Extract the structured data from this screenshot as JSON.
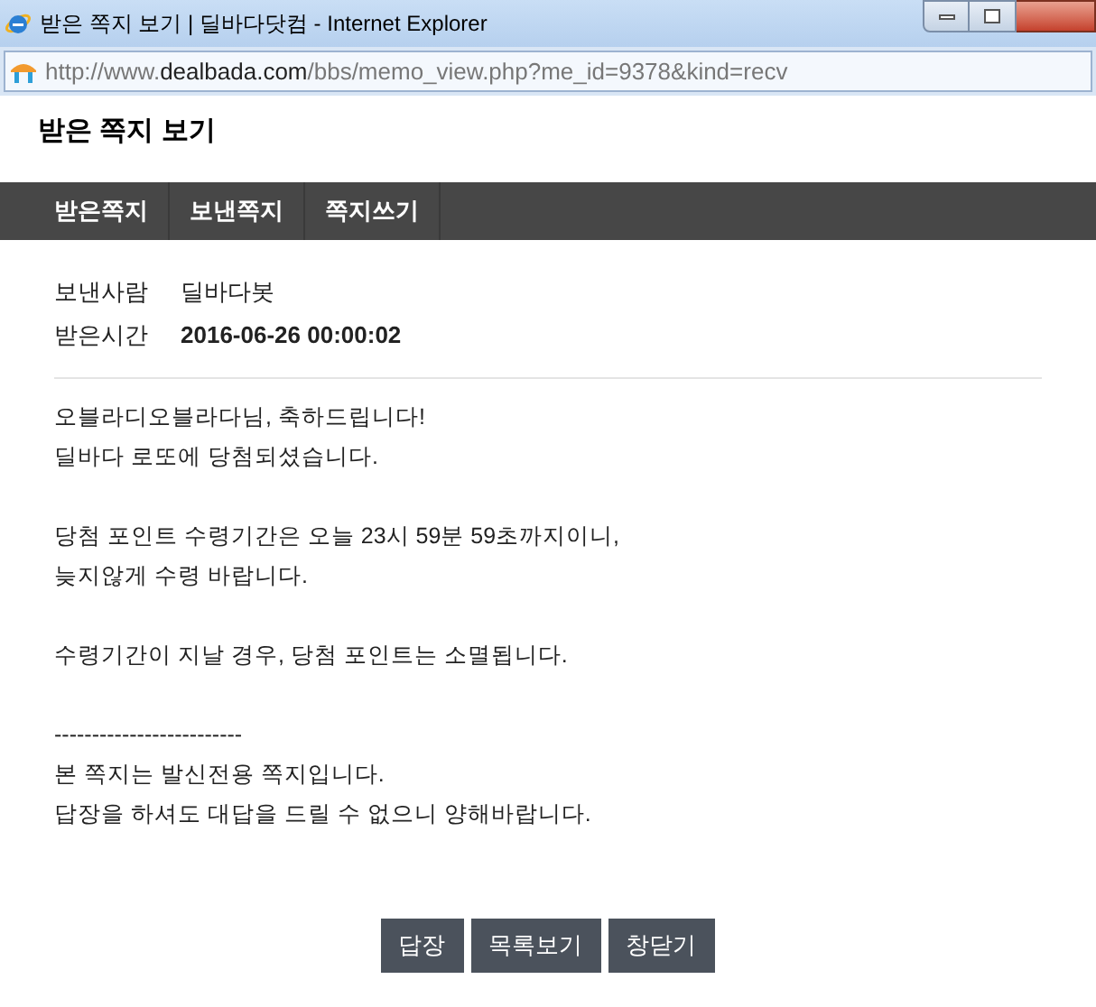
{
  "window": {
    "title": "받은 쪽지 보기 | 딜바다닷컴 - Internet Explorer"
  },
  "address_bar": {
    "url_parts": [
      {
        "text": "http://www.",
        "kind": "dim"
      },
      {
        "text": "dealbada.com",
        "kind": "domain"
      },
      {
        "text": "/bbs/memo_view.php?me_id=9378&kind=recv",
        "kind": "dim"
      }
    ]
  },
  "page_title": "받은 쪽지 보기",
  "nav": [
    {
      "label": "받은쪽지"
    },
    {
      "label": "보낸쪽지"
    },
    {
      "label": "쪽지쓰기"
    }
  ],
  "meta": [
    {
      "label": "보낸사람",
      "value": "딜바다봇",
      "kind": "normal"
    },
    {
      "label": "받은시간",
      "value": "2016-06-26 00:00:02",
      "kind": "bold"
    }
  ],
  "message_paragraphs": [
    [
      "오블라디오블라다님, 축하드립니다!",
      "딜바다 로또에 당첨되셨습니다."
    ],
    [
      "당첨 포인트 수령기간은 오늘 23시 59분 59초까지이니,",
      "늦지않게 수령 바랍니다."
    ],
    [
      "수령기간이 지날 경우, 당첨 포인트는 소멸됩니다."
    ],
    [
      "-------------------------",
      "본 쪽지는 발신전용 쪽지입니다.",
      "답장을 하셔도 대답을 드릴 수 없으니 양해바랍니다."
    ]
  ],
  "buttons": [
    "답장",
    "목록보기",
    "창닫기"
  ]
}
